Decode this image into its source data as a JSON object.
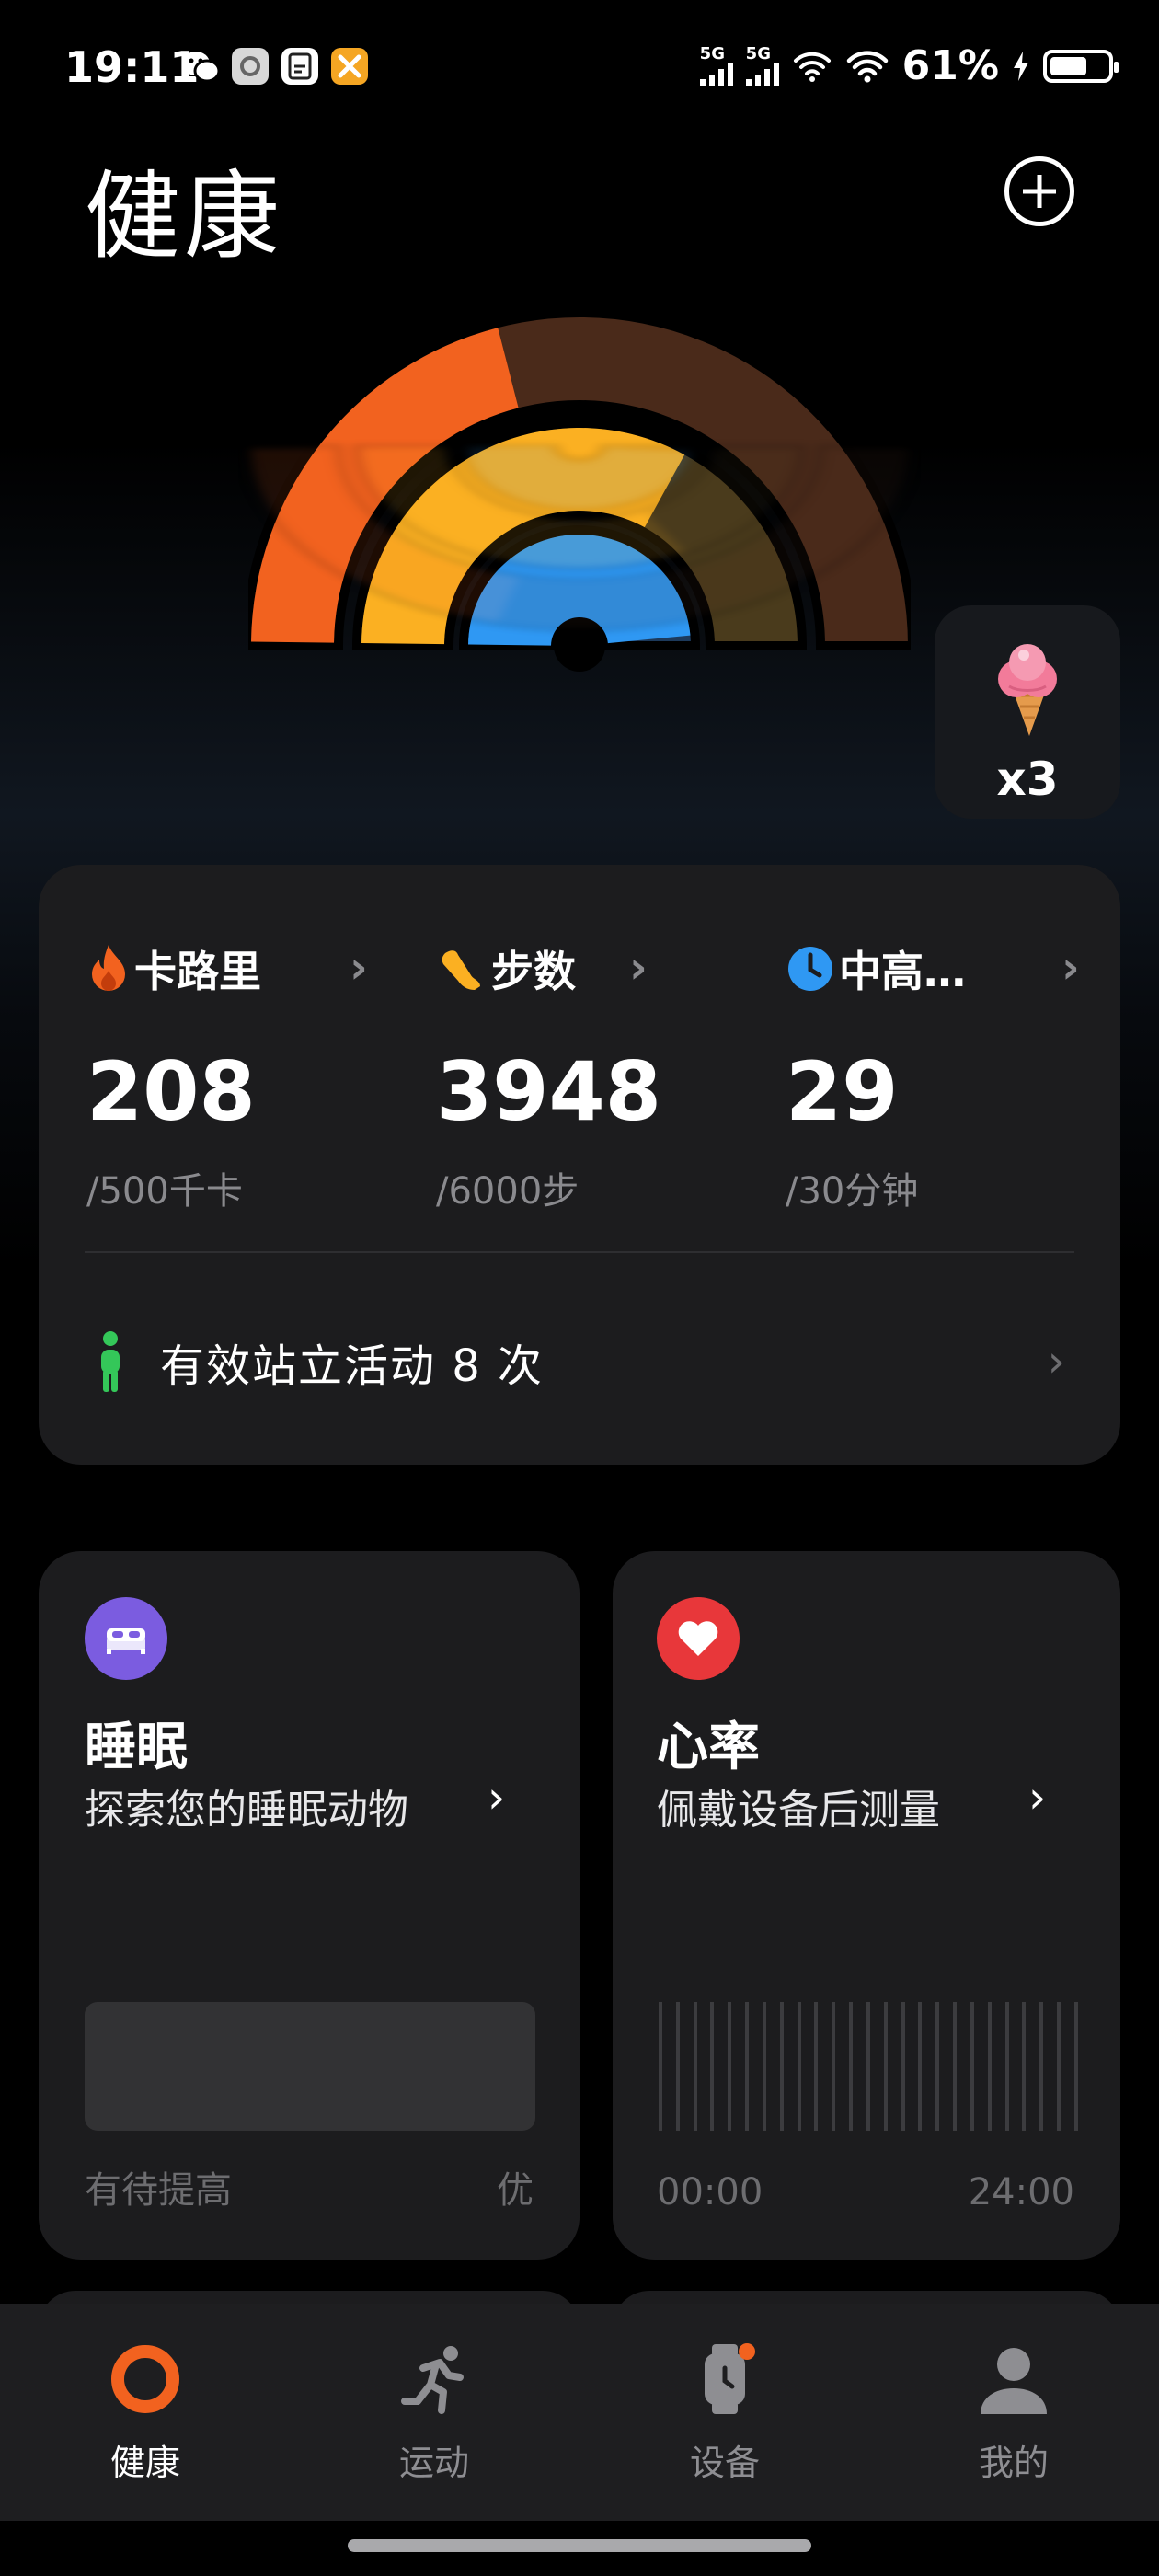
{
  "status_bar": {
    "time": "19:11",
    "network1": "5G",
    "network2": "5G",
    "battery": "61%"
  },
  "header": {
    "title": "健康"
  },
  "rings": {
    "calories_progress": 0.42,
    "steps_progress": 0.66,
    "active_minutes_progress": 0.97
  },
  "reward": {
    "count": "x3"
  },
  "activity": {
    "calories": {
      "label": "卡路里",
      "value": "208",
      "goal": "/500千卡"
    },
    "steps": {
      "label": "步数",
      "value": "3948",
      "goal": "/6000步"
    },
    "active": {
      "label": "中高…",
      "value": "29",
      "goal": "/30分钟"
    },
    "stand_text": "有效站立活动 8 次"
  },
  "sleep": {
    "title": "睡眠",
    "subtitle": "探索您的睡眠动物",
    "low_label": "有待提高",
    "high_label": "优"
  },
  "heart_rate": {
    "title": "心率",
    "subtitle": "佩戴设备后测量",
    "start_time": "00:00",
    "end_time": "24:00"
  },
  "tabs": [
    {
      "label": "健康",
      "active": true
    },
    {
      "label": "运动",
      "active": false
    },
    {
      "label": "设备",
      "active": false
    },
    {
      "label": "我的",
      "active": false
    }
  ],
  "colors": {
    "calories": "#f2621f",
    "steps": "#fbb022",
    "active": "#2f98f3",
    "stand": "#34c759",
    "sleep_icon": "#7b5ce0",
    "heart_icon": "#e8373a"
  }
}
